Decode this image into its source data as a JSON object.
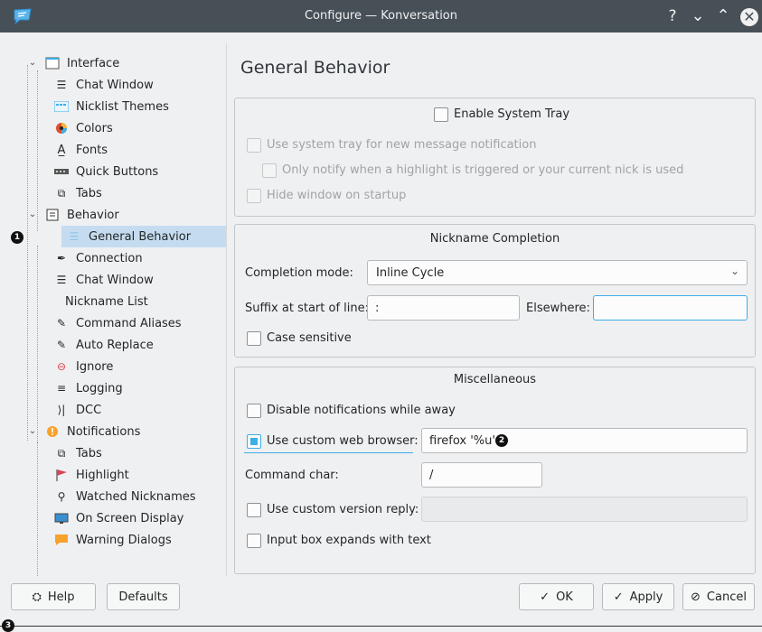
{
  "window": {
    "title": "Configure — Konversation"
  },
  "titlebar": {
    "help": "?",
    "minimize": "⌄",
    "maximize": "⌃",
    "close": "✕"
  },
  "tree": {
    "interface": "Interface",
    "chat_window": "Chat Window",
    "nicklist_themes": "Nicklist Themes",
    "colors": "Colors",
    "fonts": "Fonts",
    "quick_buttons": "Quick Buttons",
    "tabs": "Tabs",
    "behavior": "Behavior",
    "general_behavior": "General Behavior",
    "connection": "Connection",
    "behavior_chat_window": "Chat Window",
    "nickname_list": "Nickname List",
    "command_aliases": "Command Aliases",
    "auto_replace": "Auto Replace",
    "ignore": "Ignore",
    "logging": "Logging",
    "dcc": "DCC",
    "notifications": "Notifications",
    "notif_tabs": "Tabs",
    "highlight": "Highlight",
    "watched_nicknames": "Watched Nicknames",
    "on_screen_display": "On Screen Display",
    "warning_dialogs": "Warning Dialogs"
  },
  "page": {
    "title": "General Behavior"
  },
  "system_tray": {
    "enable": "Enable System Tray",
    "use_for_messages": "Use system tray for new message notification",
    "only_notify": "Only notify when a highlight is triggered or your current nick is used",
    "hide_on_startup": "Hide window on startup"
  },
  "nick_completion": {
    "title": "Nickname Completion",
    "mode_label": "Completion mode:",
    "mode_value": "Inline Cycle",
    "suffix_label": "Suffix at start of line:",
    "suffix_value": ":",
    "elsewhere_label": "Elsewhere:",
    "elsewhere_value": "",
    "case_sensitive": "Case sensitive"
  },
  "misc": {
    "title": "Miscellaneous",
    "disable_notifications": "Disable notifications while away",
    "custom_browser_label": "Use custom web browser:",
    "custom_browser_value": "firefox '%u'",
    "command_char_label": "Command char:",
    "command_char_value": "/",
    "version_reply_label": "Use custom version reply:",
    "version_reply_value": "",
    "input_expands": "Input box expands with text"
  },
  "buttons": {
    "help": "Help",
    "defaults": "Defaults",
    "ok": "OK",
    "apply": "Apply",
    "cancel": "Cancel"
  },
  "markers": {
    "m1": "1",
    "m2": "2",
    "m3": "3"
  },
  "colors": {
    "accent": "#3daee9",
    "titlebar": "#475057",
    "selection": "#c5dcf0"
  }
}
